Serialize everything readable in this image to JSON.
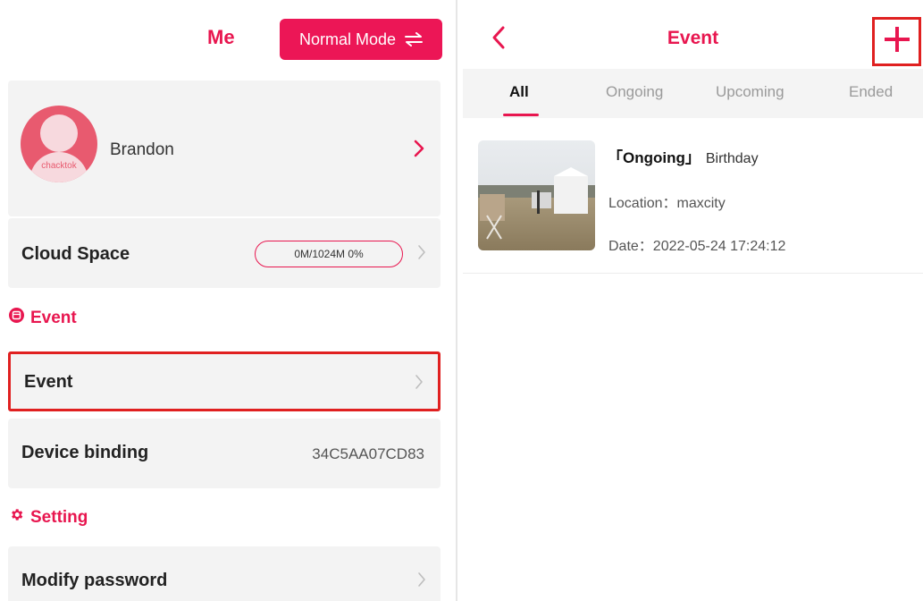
{
  "header": {
    "title": "Me",
    "mode_button_label": "Normal Mode"
  },
  "profile": {
    "name": "Brandon",
    "avatar_text": "chacktok"
  },
  "cloud": {
    "label": "Cloud Space",
    "usage": "0M/1024M 0%"
  },
  "sections": {
    "event": "Event",
    "setting": "Setting"
  },
  "rows": {
    "event": "Event",
    "device_binding": "Device binding",
    "device_id": "34C5AA07CD83",
    "modify_password": "Modify password"
  },
  "event_page": {
    "title": "Event",
    "tabs": [
      {
        "label": "All",
        "active": true
      },
      {
        "label": "Ongoing",
        "active": false
      },
      {
        "label": "Upcoming",
        "active": false
      },
      {
        "label": "Ended",
        "active": false
      }
    ],
    "items": [
      {
        "status": "「Ongoing」",
        "name": "Birthday",
        "location": "Location：maxcity",
        "date": "Date：2022-05-24 17:24:12"
      }
    ]
  },
  "colors": {
    "accent": "#e8164f",
    "highlight_border": "#e02020",
    "card_bg": "#f3f3f3"
  },
  "icons": {
    "mode_switch": "swap-arrows-icon",
    "event_section": "event-badge-icon",
    "setting_section": "gear-icon",
    "back": "chevron-left-icon",
    "add": "plus-icon"
  }
}
